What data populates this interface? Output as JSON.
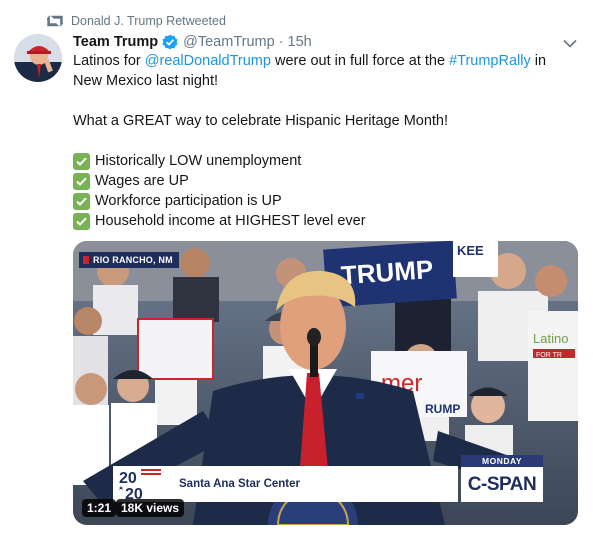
{
  "retweet_context": {
    "text": "Donald J. Trump Retweeted",
    "icon": "retweet-icon"
  },
  "author": {
    "display_name": "Team Trump",
    "handle": "@TeamTrump",
    "separator": "·",
    "time": "15h",
    "verified": true,
    "avatar_icon": "avatar"
  },
  "tweet": {
    "line1_prefix": "Latinos for ",
    "mention": "@realDonaldTrump",
    "line1_middle": " were out in full force at the ",
    "hashtag": "#TrumpRally",
    "line1_suffix": " in New Mexico last night!",
    "paragraph2": "What a GREAT way to celebrate Hispanic Heritage Month!",
    "checklist": [
      "Historically LOW unemployment",
      "Wages are UP",
      "Workforce participation is UP",
      "Household income at HIGHEST level ever"
    ]
  },
  "media": {
    "location_chip": "RIO RANCHO, NM",
    "logo_top": "20",
    "logo_bottom": "20",
    "venue": "Santa Ana Star Center",
    "day": "MONDAY",
    "network": "C-SPAN",
    "sign_trump": "TRUMP",
    "sign_partial": "KEE",
    "sign_partial2": "mer",
    "sign_partial3": "RUMP",
    "shirt_text": "Latino",
    "shirt_sub": "FOR TR",
    "duration": "1:21",
    "views": "18K views"
  },
  "colors": {
    "link": "#1b95e0",
    "muted": "#657786",
    "verified": "#1da1f2",
    "check": "#77b255",
    "cspan_navy": "#1e2d5c"
  }
}
